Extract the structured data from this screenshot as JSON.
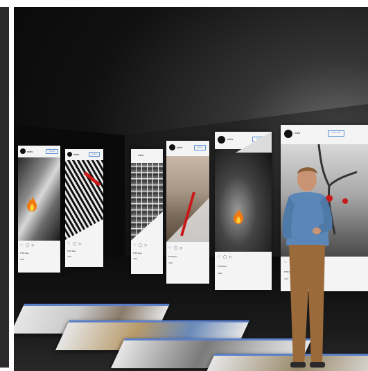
{
  "exhibit": {
    "posts": [
      {
        "handle": "nsfw",
        "follow": "Follow",
        "likes": "♥ 58 likes",
        "caption": "nsfw"
      },
      {
        "handle": "nsfw",
        "follow": "Follow",
        "likes": "♥ 58 likes",
        "caption": "nsfw"
      },
      {
        "handle": "nsfw",
        "follow": "Follow",
        "likes": "♥ 58 likes",
        "caption": "nsfw"
      },
      {
        "handle": "nsfw",
        "follow": "Follow",
        "likes": "♥ 58 likes",
        "caption": "nsfw"
      },
      {
        "handle": "nsfw",
        "follow": "Follow",
        "likes": "♥ 58 likes",
        "caption": "nsfw"
      },
      {
        "handle": "nsfw",
        "follow": "FOLLOW",
        "likes": "♥ 58 likes",
        "caption": "nsfw"
      }
    ],
    "colors": {
      "follow_blue": "#5b8fd6",
      "censor_red": "#c81a1a",
      "flame": "#f07a10",
      "feed_blue": "#5a7fc8"
    },
    "icons": [
      "heart-icon",
      "comment-icon",
      "share-icon",
      "bookmark-icon",
      "flame-icon"
    ]
  }
}
